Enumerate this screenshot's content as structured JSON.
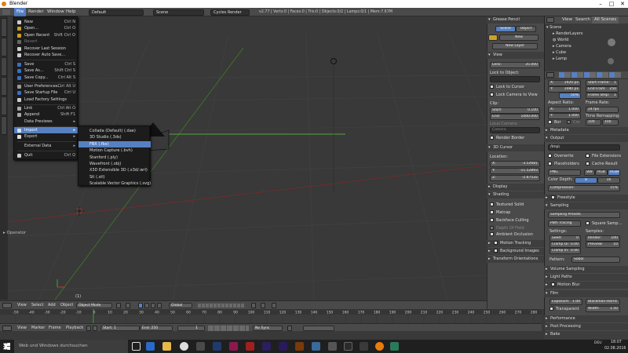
{
  "window": {
    "title": "Blender"
  },
  "topbar": {
    "menus": [
      "File",
      "Render",
      "Window",
      "Help"
    ],
    "layout": "Default",
    "scene": "Scene",
    "engine": "Cycles Render",
    "stats": "v2.77 | Verts:0 | Faces:0 | Tris:0 | Objects:0/2 | Lamps:0/1 | Mem:7.67M"
  },
  "file_menu": {
    "items": [
      {
        "label": "New",
        "shortcut": "Ctrl N"
      },
      {
        "label": "Open...",
        "shortcut": "Ctrl O"
      },
      {
        "label": "Open Recent",
        "shortcut": "Shift Ctrl O"
      },
      {
        "label": "Revert",
        "shortcut": ""
      },
      {
        "label": "Recover Last Session",
        "shortcut": ""
      },
      {
        "label": "Recover Auto Save...",
        "shortcut": ""
      },
      {
        "label": "Save",
        "shortcut": "Ctrl S"
      },
      {
        "label": "Save As...",
        "shortcut": "Shift Ctrl S"
      },
      {
        "label": "Save Copy...",
        "shortcut": "Ctrl Alt S"
      },
      {
        "label": "User Preferences...",
        "shortcut": "Ctrl Alt U"
      },
      {
        "label": "Save Startup File",
        "shortcut": "Ctrl U"
      },
      {
        "label": "Load Factory Settings",
        "shortcut": ""
      },
      {
        "label": "Link",
        "shortcut": "Ctrl Alt O"
      },
      {
        "label": "Append",
        "shortcut": "Shift F1"
      },
      {
        "label": "Data Previews",
        "shortcut": "▸"
      },
      {
        "label": "Import",
        "shortcut": "▸"
      },
      {
        "label": "Export",
        "shortcut": "▸"
      },
      {
        "label": "External Data",
        "shortcut": "▸"
      },
      {
        "label": "Quit",
        "shortcut": "Ctrl Q"
      }
    ]
  },
  "import_menu": {
    "items": [
      "Collada (Default) (.dae)",
      "3D Studio (.3ds)",
      "FBX (.fbx)",
      "Motion Capture (.bvh)",
      "Stanford (.ply)",
      "Wavefront (.obj)",
      "X3D Extensible 3D (.x3d/.wrl)",
      "Stl (.stl)",
      "Scalable Vector Graphics (.svg)"
    ]
  },
  "toolshelf": {
    "operator": "Operator"
  },
  "viewport": {
    "object_label": "(1)"
  },
  "view_toolbar": {
    "items": [
      "View",
      "Select",
      "Add",
      "Object"
    ],
    "mode": "Object Mode",
    "pivot": "Global"
  },
  "timeline": {
    "ticks": [
      "-50",
      "-40",
      "-30",
      "-20",
      "-10",
      "0",
      "10",
      "20",
      "30",
      "40",
      "50",
      "60",
      "70",
      "80",
      "90",
      "100",
      "110",
      "120",
      "130",
      "140",
      "150",
      "160",
      "170",
      "180",
      "190",
      "200",
      "210",
      "220",
      "230",
      "240",
      "250",
      "260",
      "270",
      "280"
    ],
    "menu": [
      "View",
      "Marker",
      "Frame",
      "Playback"
    ],
    "start_label": "Start:",
    "start": "1",
    "end_label": "End:",
    "end": "250",
    "current": "1",
    "sync": "No Sync"
  },
  "properties": {
    "grease_pencil": "Grease Pencil",
    "gp_tabs": [
      "Scene",
      "Object"
    ],
    "new": "New",
    "new_layer": "New Layer",
    "view": "View",
    "lens_label": "Lens:",
    "lens": "35.000",
    "lock_to_object": "Lock to Object:",
    "lock_to_cursor": "Lock to Cursor",
    "lock_camera": "Lock Camera to View",
    "clip": "Clip:",
    "clip_start_label": "Start:",
    "clip_start": "0.100",
    "clip_end_label": "End:",
    "clip_end": "1000.000",
    "local_camera": "Local Camera:",
    "camera": "Camera",
    "render_border": "Render Border",
    "cursor": "3D Cursor",
    "location": "Location:",
    "x_label": "X:",
    "x": "-3.52681",
    "y_label": "Y:",
    "y": "-11.52893",
    "z_label": "Z:",
    "z": "-2.87532",
    "closed": [
      "Display",
      "Shading"
    ],
    "shading": [
      "Textured Solid",
      "Matcap",
      "Backface Culling",
      "Depth Of Field",
      "Ambient Occlusion"
    ],
    "closed2": [
      "Motion Tracking",
      "Background Images",
      "Transform Orientations"
    ]
  },
  "outliner": {
    "tabs": [
      "View",
      "Search",
      "All Scenes"
    ],
    "items": [
      "Scene",
      "RenderLayers",
      "World",
      "Camera",
      "Cube",
      "Lamp"
    ]
  },
  "render": {
    "res_x_label": "X:",
    "res_x": "1920 px",
    "res_y_label": "Y:",
    "res_y": "1080 px",
    "res_pct": "50%",
    "start_frame": "Start Frame:",
    "start_frame_val": "1",
    "end_frame": "End Fram:",
    "end_frame_val": "250",
    "frame_step": "Frame Step:",
    "frame_step_val": "1",
    "aspect": "Aspect Ratio:",
    "asp_x": "1.000",
    "asp_y": "1.000",
    "frame_rate": "Frame Rate:",
    "fps": "24 fps",
    "time_remap": "Time Remapping:",
    "remap_old": "100",
    "remap_new": "100",
    "border": "Bor",
    "crop": "Cro",
    "metadata": "Metadata",
    "output": "Output",
    "output_path": "/tmp\\",
    "overwrite": "Overwrite",
    "file_ext": "File Extensions",
    "placeholders": "Placeholders",
    "cache_result": "Cache Result",
    "format": "PNG",
    "bw": "BW",
    "rgb": "RGB",
    "rgba": "RGBA",
    "color_depth": "Color Depth:",
    "depth_8": "8",
    "depth_16": "16",
    "compression_label": "Compression:",
    "compression": "15%",
    "freestyle": "Freestyle",
    "sampling": "Sampling",
    "sampling_presets": "Sampling Presets",
    "path_tracing": "Path Tracing",
    "square_samples": "Square Samp...",
    "settings": "Settings:",
    "seed_label": "Seed:",
    "seed": "0",
    "clamp_direct": "Clamp Di:",
    "clamp_direct_val": "0.00",
    "clamp_indirect": "Clamp In:",
    "clamp_indirect_val": "0.00",
    "samples": "Samples:",
    "render_label": "Render:",
    "render_samples": "100",
    "preview_label": "Preview:",
    "preview_samples": "10",
    "pattern_label": "Pattern:",
    "pattern": "Sobol",
    "volume_sampling": "Volume Sampling",
    "light_paths": "Light Paths",
    "motion_blur": "Motion Blur",
    "film": "Film",
    "exposure_label": "Exposure:",
    "exposure": "1.00",
    "filter": "Blackman-Harris",
    "transparent": "Transparent",
    "width_label": "Width:",
    "width": "1.50",
    "performance": "Performance",
    "post_processing": "Post Processing",
    "bake": "Bake"
  },
  "taskbar": {
    "search": "Web und Windows durchsuchen",
    "time": "18:07",
    "date": "02.08.2016",
    "lang": "DEU"
  }
}
